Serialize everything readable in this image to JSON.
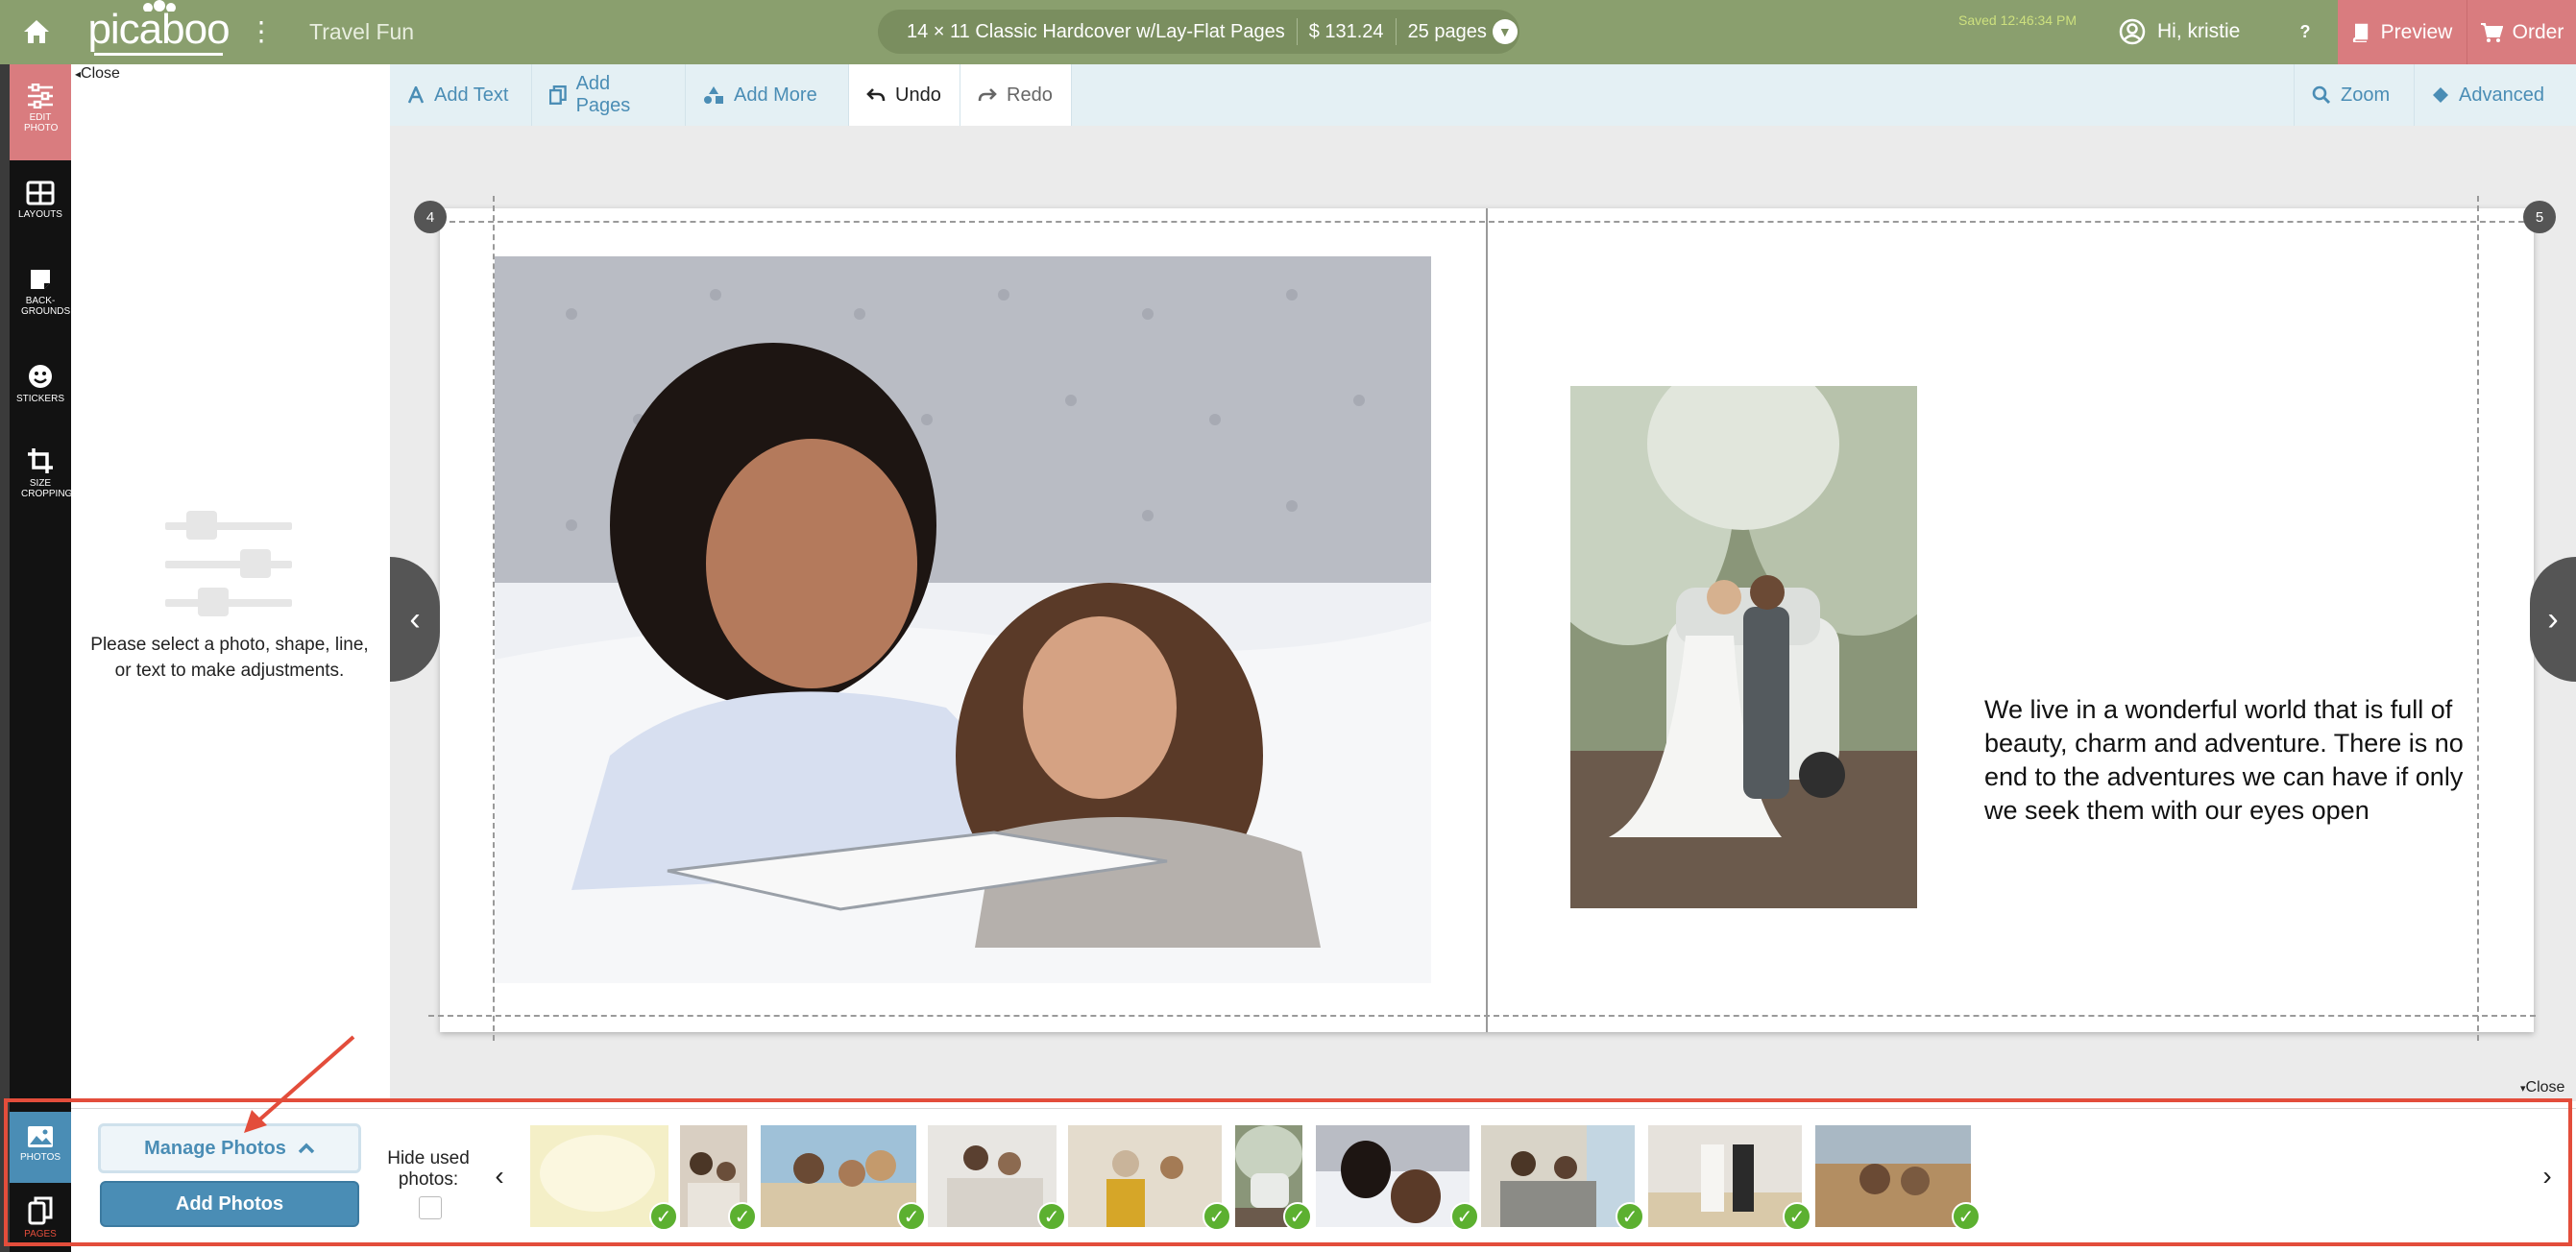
{
  "header": {
    "logo_text": "picaboo",
    "project_title": "Travel Fun",
    "product": "14 × 11 Classic Hardcover w/Lay-Flat Pages",
    "price": "$ 131.24",
    "pages": "25 pages",
    "saved_status": "Saved 12:46:34 PM",
    "greeting": "Hi, kristie",
    "help": "?",
    "preview_label": "Preview",
    "order_label": "Order"
  },
  "rail": {
    "edit_photo": "EDIT PHOTO",
    "layouts": "LAYOUTS",
    "backgrounds": "BACK-GROUNDS",
    "stickers": "STICKERS",
    "size_cropping": "SIZE CROPPING",
    "photos": "PHOTOS",
    "pages": "PAGES"
  },
  "edit_panel": {
    "close_label": "Close",
    "hint": "Please select a photo, shape, line, or text to make adjustments."
  },
  "toolbar": {
    "add_text": "Add Text",
    "add_pages": "Add Pages",
    "add_more": "Add More",
    "undo": "Undo",
    "redo": "Redo",
    "zoom": "Zoom",
    "advanced": "Advanced"
  },
  "spread": {
    "left_page_number": "4",
    "right_page_number": "5",
    "text_box": "We live in a wonderful world that is full of beauty, charm and adventure. There is no end to the adventures we can have if only we seek them with our eyes open"
  },
  "tray": {
    "close_label": "Close",
    "manage_photos": "Manage Photos",
    "add_photos": "Add Photos",
    "hide_used_label": "Hide used photos:",
    "hide_used_checked": false
  },
  "colors": {
    "topbar": "#8a9f6e",
    "accent_pink": "#d97c7f",
    "accent_blue": "#4a8db5",
    "annotation_red": "#e34d3b",
    "used_check": "#5cb030"
  }
}
